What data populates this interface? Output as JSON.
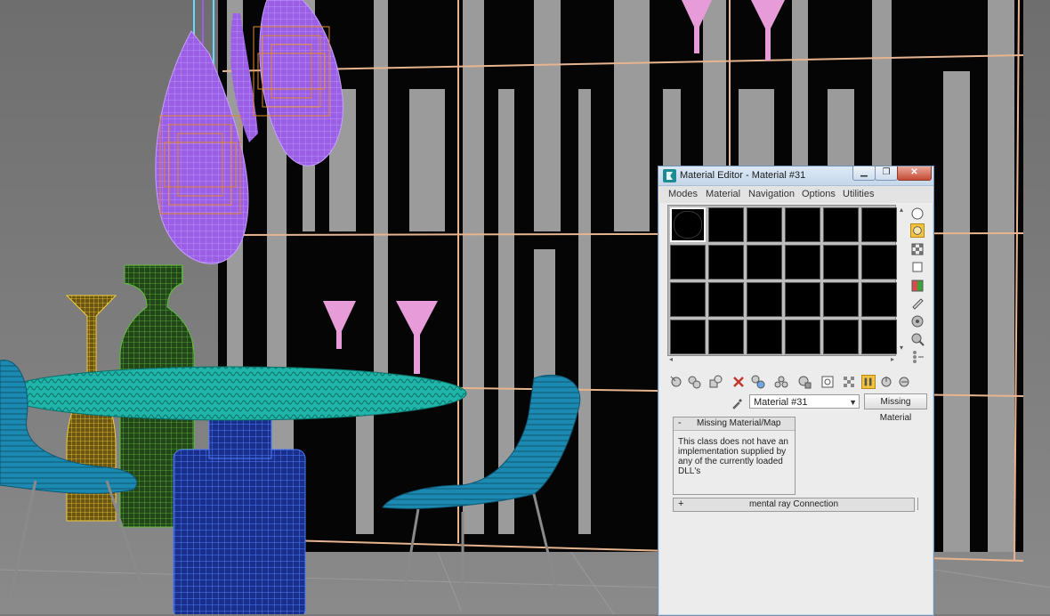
{
  "window": {
    "title": "Material Editor - Material #31",
    "minimize": "▁",
    "maximize": "❐",
    "close": "✕"
  },
  "menu": [
    "Modes",
    "Material",
    "Navigation",
    "Options",
    "Utilities"
  ],
  "sample_slots": {
    "rows": 4,
    "columns": 6,
    "active_index": 0
  },
  "side_tools": [
    "sample-type-icon",
    "backlight-icon",
    "background-icon",
    "sample-uv-tiling-icon",
    "video-color-check-icon",
    "make-preview-icon",
    "options-icon",
    "select-by-material-icon",
    "material-map-navigator-icon"
  ],
  "horizontal_tools": [
    "get-material-icon",
    "put-to-scene-icon",
    "assign-to-selection-icon",
    "reset-map-icon",
    "make-copy-icon",
    "make-unique-icon",
    "put-to-library-icon",
    "material-id-channel-icon",
    "show-map-icon",
    "show-end-result-icon",
    "go-to-parent-icon",
    "go-forward-sibling-icon"
  ],
  "material": {
    "name": "Material #31",
    "type_button": "Missing Material"
  },
  "rollout_missing": {
    "sign": "-",
    "title": "Missing Material/Map",
    "body": "This class does not have an implementation supplied by any of the currently loaded DLL's"
  },
  "rollout_mentalray": {
    "sign": "+",
    "title": "mental ray Connection"
  },
  "colors": {
    "title_bar": "#c5d7ea",
    "window_bg": "#ececec",
    "wire_purple": "#9b5fe6",
    "wire_orange": "#e08a2a",
    "wire_teal": "#1fb4a8",
    "wire_blue": "#2d5fd6",
    "wire_pink": "#e79bd8",
    "wire_yellow": "#d9b52b",
    "wire_green": "#3b8a2a"
  }
}
